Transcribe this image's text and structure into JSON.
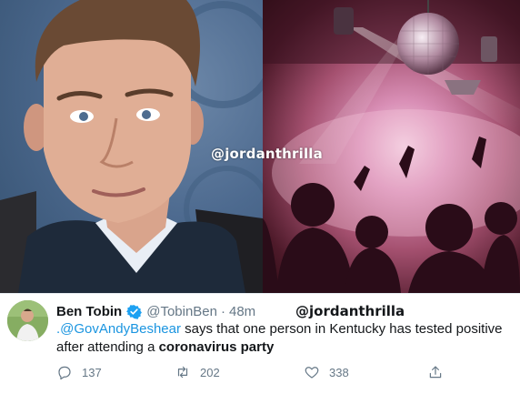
{
  "photo_watermark": "@jordanthrilla",
  "tweet": {
    "display_name": "Ben Tobin",
    "verified": true,
    "handle": "@TobinBen",
    "separator": "·",
    "age": "48m",
    "overlay_watermark": "@jordanthrilla",
    "text": {
      "mention": ".@GovAndyBeshear",
      "part1": " says that one person in Kentucky has tested positive after attending a ",
      "bold": "coronavirus party"
    },
    "actions": {
      "replies": "137",
      "retweets": "202",
      "likes": "338"
    }
  },
  "colors": {
    "accent": "#1b95e0",
    "verified_badge": "#1da1f2",
    "secondary_text": "#657786",
    "primary_text": "#14171a"
  },
  "icons": [
    "verified-badge-icon",
    "reply-icon",
    "retweet-icon",
    "like-icon",
    "share-icon"
  ]
}
